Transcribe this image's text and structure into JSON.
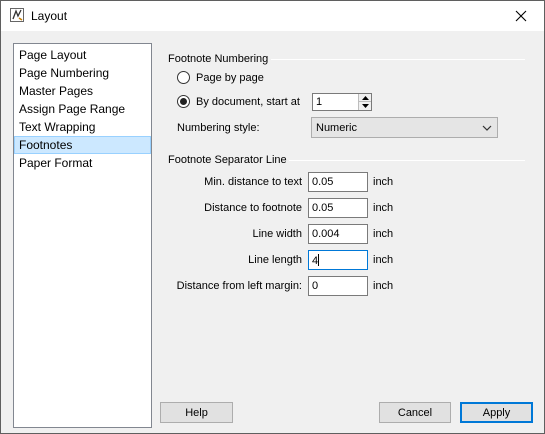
{
  "window": {
    "title": "Layout"
  },
  "sidebar": {
    "items": [
      {
        "label": "Page Layout"
      },
      {
        "label": "Page Numbering"
      },
      {
        "label": "Master Pages"
      },
      {
        "label": "Assign Page Range"
      },
      {
        "label": "Text Wrapping"
      },
      {
        "label": "Footnotes",
        "selected": true
      },
      {
        "label": "Paper Format"
      }
    ]
  },
  "numbering": {
    "heading": "Footnote Numbering",
    "page_by_page": "Page by page",
    "by_document": "By document, start at",
    "start_value": "1",
    "style_label": "Numbering style:",
    "style_value": "Numeric"
  },
  "separator": {
    "heading": "Footnote Separator Line",
    "min_distance_label": "Min. distance to text",
    "min_distance_value": "0.05",
    "distance_footnote_label": "Distance to footnote",
    "distance_footnote_value": "0.05",
    "line_width_label": "Line width",
    "line_width_value": "0.004",
    "line_length_label": "Line length",
    "line_length_value": "4",
    "left_margin_label": "Distance from left margin:",
    "left_margin_value": "0",
    "unit": "inch"
  },
  "buttons": {
    "help": "Help",
    "cancel": "Cancel",
    "apply": "Apply"
  }
}
